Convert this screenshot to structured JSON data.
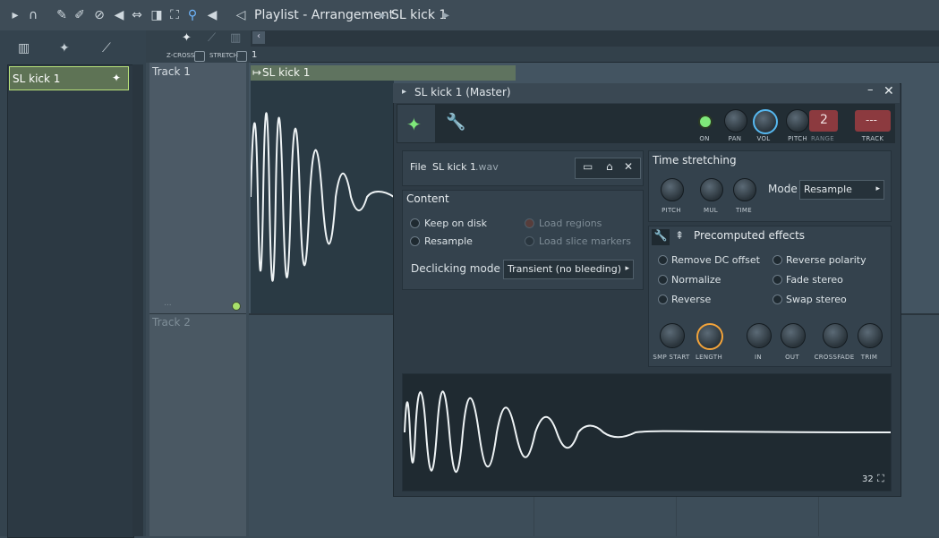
{
  "toolbar": {
    "crumb_playlist": "Playlist - Arrangement",
    "crumb_pattern": "SL kick 1"
  },
  "browser": {
    "item_label": "SL kick 1"
  },
  "playlist": {
    "zcross_label": "Z-CROSS",
    "stretch_label": "STRETCH",
    "ruler_1": "1",
    "track1": "Track 1",
    "track2": "Track 2",
    "clip_label": "SL kick 1",
    "dots": "..."
  },
  "window": {
    "title": "SL kick 1 (Master)",
    "header": {
      "on": "ON",
      "pan": "PAN",
      "vol": "VOL",
      "pitch": "PITCH",
      "range": "RANGE",
      "range_value": "2",
      "track": "TRACK",
      "track_value": "---"
    },
    "file": {
      "label": "File",
      "name": "SL kick 1",
      "ext": ".wav"
    },
    "content": {
      "title": "Content",
      "keep_on_disk": "Keep on disk",
      "resample": "Resample",
      "load_regions": "Load regions",
      "load_slice_markers": "Load slice markers",
      "declicking_label": "Declicking mode",
      "declicking_value": "Transient (no bleeding)"
    },
    "time_stretching": {
      "title": "Time stretching",
      "pitch": "PITCH",
      "mul": "MUL",
      "time": "TIME",
      "mode_label": "Mode",
      "mode_value": "Resample"
    },
    "precomputed": {
      "title": "Precomputed effects",
      "remove_dc": "Remove DC offset",
      "normalize": "Normalize",
      "reverse": "Reverse",
      "reverse_polarity": "Reverse polarity",
      "fade_stereo": "Fade stereo",
      "swap_stereo": "Swap stereo",
      "knobs": [
        "SMP START",
        "LENGTH",
        "IN",
        "OUT",
        "CROSSFADE",
        "TRIM"
      ]
    },
    "waveform": {
      "zoom": "32"
    }
  },
  "colors": {
    "accent_green": "#7fe87a",
    "accent_orange": "#f2a33a",
    "clip_green": "#5f735f",
    "range_red": "#8c3a3f"
  }
}
